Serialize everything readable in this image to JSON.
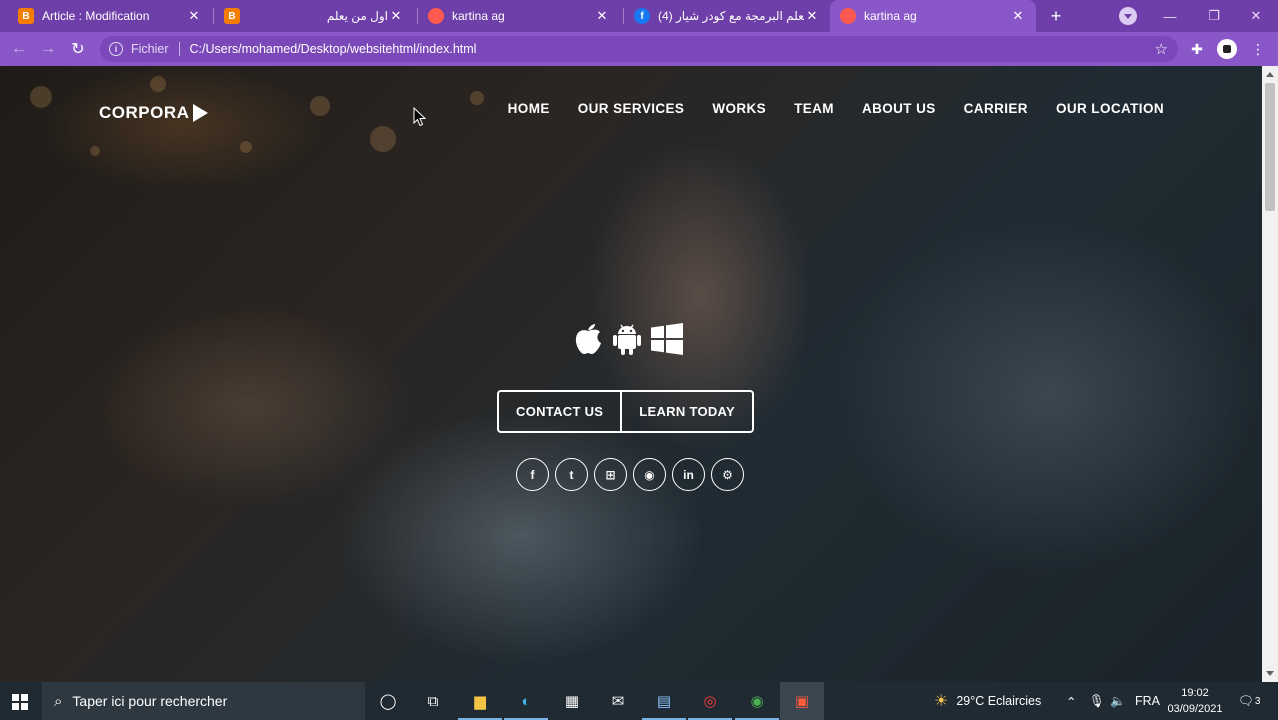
{
  "browser": {
    "tabs": [
      {
        "title": "Article : Modification",
        "favicon": "blogger-icon",
        "active": false
      },
      {
        "title": "",
        "favicon": "blogger-icon",
        "active": false
      },
      {
        "title": "اول من يعلم",
        "favicon": "red-dot-icon",
        "active": false
      },
      {
        "title": "kartina ag",
        "favicon": "red-dot-icon",
        "active": false
      },
      {
        "title": "(4) تعلم البرمجة مع كودر شيار",
        "favicon": "facebook-icon",
        "active": false
      },
      {
        "title": "kartina ag",
        "favicon": "red-dot-icon",
        "active": true
      }
    ],
    "address": {
      "scheme_label": "Fichier",
      "url": "C:/Users/mohamed/Desktop/websitehtml/index.html"
    },
    "accent": "#8a57c9",
    "frame": "#6e3fa8"
  },
  "site": {
    "logo": "CORPORA",
    "nav": [
      "HOME",
      "OUR SERVICES",
      "WORKS",
      "TEAM",
      "ABOUT US",
      "CARRIER",
      "OUR LOCATION"
    ],
    "platforms": [
      "apple-icon",
      "android-icon",
      "windows-icon"
    ],
    "buttons": {
      "contact": "CONTACT US",
      "learn": "LEARN TODAY"
    },
    "social": [
      {
        "icon": "facebook-icon",
        "glyph": "f"
      },
      {
        "icon": "twitter-icon",
        "glyph": "t"
      },
      {
        "icon": "windows-icon",
        "glyph": "⊞"
      },
      {
        "icon": "reddit-icon",
        "glyph": "◉"
      },
      {
        "icon": "linkedin-icon",
        "glyph": "in"
      },
      {
        "icon": "gear-icon",
        "glyph": "⚙"
      }
    ]
  },
  "taskbar": {
    "search_placeholder": "Taper ici pour rechercher",
    "weather": "29°C  Eclaircies",
    "language": "FRA",
    "time": "19:02",
    "date": "03/09/2021",
    "notifications": "3"
  }
}
